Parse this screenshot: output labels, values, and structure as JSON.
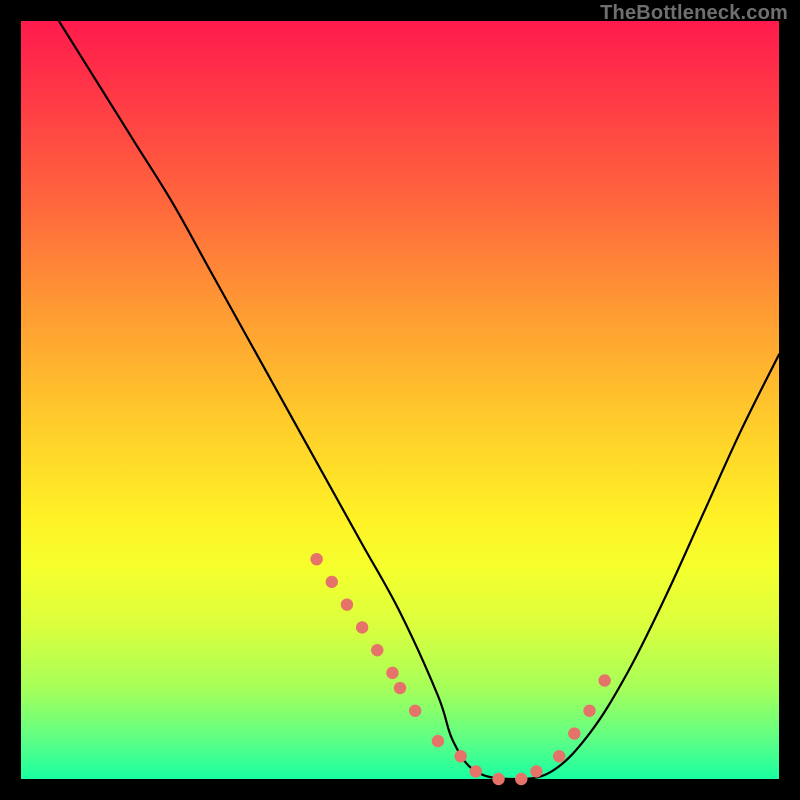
{
  "watermark": "TheBottleneck.com",
  "chart_data": {
    "type": "line",
    "title": "",
    "xlabel": "",
    "ylabel": "",
    "xlim": [
      0,
      100
    ],
    "ylim": [
      0,
      100
    ],
    "grid": false,
    "legend": false,
    "series": [
      {
        "name": "bottleneck-curve",
        "color": "#000000",
        "x": [
          5,
          10,
          15,
          20,
          25,
          30,
          35,
          40,
          45,
          50,
          55,
          57,
          60,
          65,
          70,
          75,
          80,
          85,
          90,
          95,
          100
        ],
        "y": [
          100,
          92,
          84,
          76,
          67,
          58,
          49,
          40,
          31,
          22,
          11,
          5,
          1,
          0,
          1,
          6,
          14,
          24,
          35,
          46,
          56
        ]
      },
      {
        "name": "salmon-highlight-dots",
        "color": "#e5736a",
        "x": [
          39,
          41,
          43,
          45,
          47,
          49,
          50,
          52,
          55,
          58,
          60,
          63,
          66,
          68,
          71,
          73,
          75,
          77
        ],
        "y": [
          29,
          26,
          23,
          20,
          17,
          14,
          12,
          9,
          5,
          3,
          1,
          0,
          0,
          1,
          3,
          6,
          9,
          13
        ]
      }
    ]
  }
}
